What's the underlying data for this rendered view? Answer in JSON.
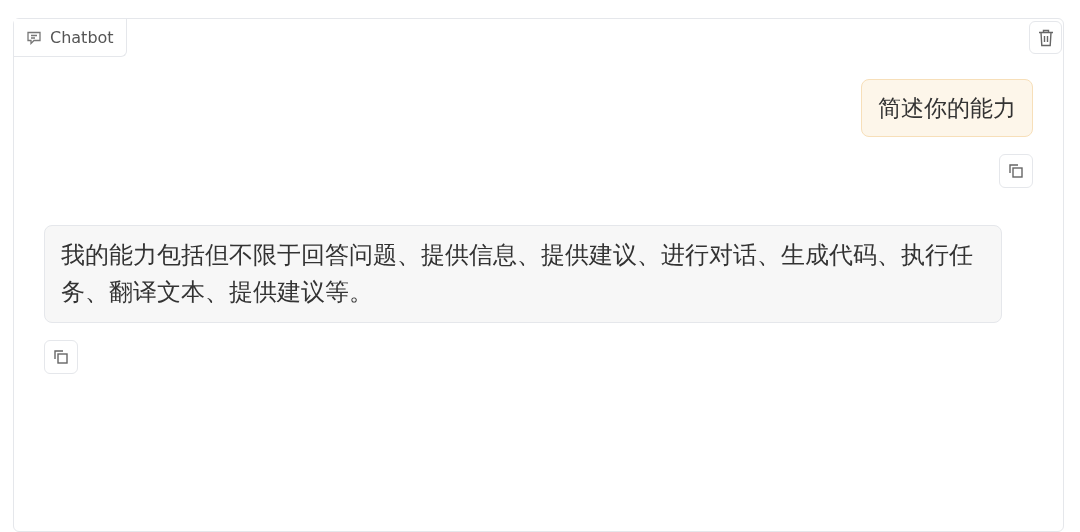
{
  "chatbot": {
    "label": "Chatbot",
    "messages": [
      {
        "kind": "user",
        "text": "简述你的能力"
      },
      {
        "kind": "bot",
        "text": "我的能力包括但不限于回答问题、提供信息、提供建议、进行对话、生成代码、执行任务、翻译文本、提供建议等。"
      }
    ]
  }
}
